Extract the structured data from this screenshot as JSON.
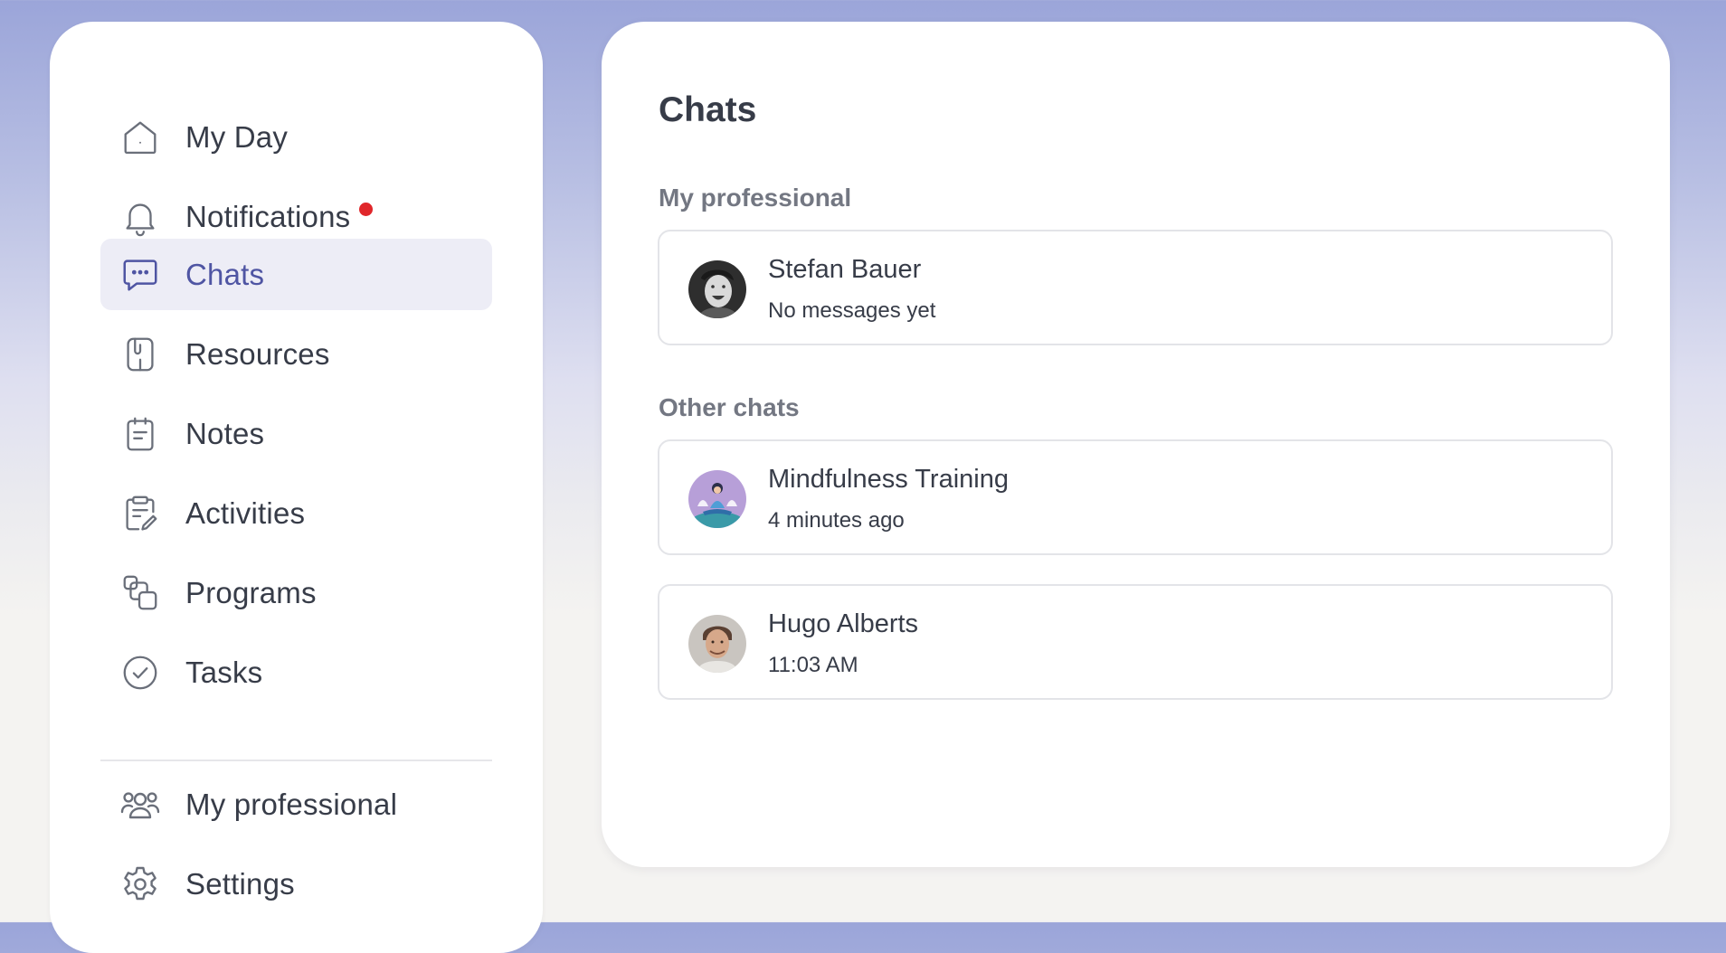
{
  "sidebar": {
    "items": [
      {
        "label": "My Day",
        "icon": "home-icon"
      },
      {
        "label": "Notifications",
        "icon": "bell-icon",
        "has_alert": true
      },
      {
        "label": "Chats",
        "icon": "chat-bubble-icon",
        "active": true
      },
      {
        "label": "Resources",
        "icon": "resources-icon"
      },
      {
        "label": "Notes",
        "icon": "notepad-icon"
      },
      {
        "label": "Activities",
        "icon": "clipboard-edit-icon"
      },
      {
        "label": "Programs",
        "icon": "programs-icon"
      },
      {
        "label": "Tasks",
        "icon": "check-circle-icon"
      }
    ],
    "bottom_items": [
      {
        "label": "My professional",
        "icon": "users-icon"
      },
      {
        "label": "Settings",
        "icon": "gear-icon"
      }
    ]
  },
  "main": {
    "title": "Chats",
    "sections": [
      {
        "title": "My professional",
        "chats": [
          {
            "name": "Stefan Bauer",
            "subtitle": "No messages yet",
            "avatar": "stefan-bauer-avatar"
          }
        ]
      },
      {
        "title": "Other chats",
        "chats": [
          {
            "name": "Mindfulness Training",
            "subtitle": "4 minutes ago",
            "avatar": "mindfulness-avatar"
          },
          {
            "name": "Hugo Alberts",
            "subtitle": "11:03 AM",
            "avatar": "hugo-alberts-avatar"
          }
        ]
      }
    ]
  },
  "colors": {
    "accent": "#4f55a3",
    "active_bg": "#ededf6",
    "alert_dot": "#e0262a",
    "text": "#373c48",
    "muted_text": "#737782"
  }
}
